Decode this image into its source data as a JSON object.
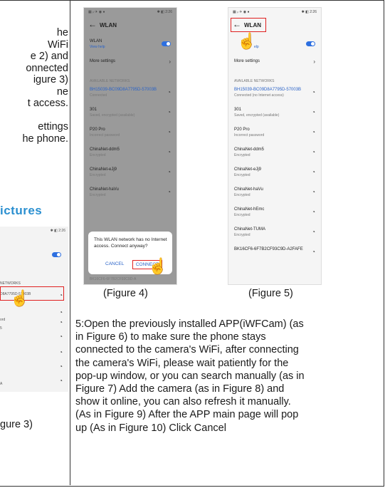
{
  "left_column": {
    "text_lines": [
      "he",
      "WiFi",
      "e 2) and",
      "onnected",
      "igure 3)",
      "ne",
      "t access.",
      "",
      "ettings",
      "he phone."
    ],
    "heading": "ictures",
    "figure3": {
      "status": "✱ ◧ 2:26",
      "rows": [
        "NETWORKS",
        "D8A7795D-57003B",
        "",
        "ord",
        "5",
        "",
        "",
        "",
        "A",
        ""
      ],
      "caption": "gure 3)"
    }
  },
  "figure4": {
    "status_left": "▦ ᵢₗ ✈ ◉ ●",
    "status_right": "✱ ◧ 2:26",
    "title": "WLAN",
    "wlan_label": "WLAN",
    "view_help": "View help",
    "more_settings": "More settings",
    "available": "AVAILABLE NETWORKS",
    "networks": [
      {
        "name": "BH15039-BC09D8A7795D-57003B",
        "status": "Connected",
        "blue": true
      },
      {
        "name": "301",
        "status": "Saved, encrypted (available)"
      },
      {
        "name": "P20 Pro",
        "status": "Incorrect password"
      },
      {
        "name": "ChinaNet-ddm5",
        "status": "Encrypted"
      },
      {
        "name": "ChinaNet-eJj9",
        "status": "Encrypted"
      },
      {
        "name": "ChinaNet-haVu",
        "status": "Encrypted"
      }
    ],
    "dialog_text": "This WLAN network has no Internet access. Connect anyway?",
    "cancel": "CANCEL",
    "connect": "CONNECT",
    "bottom_partial": "BK16CF6-6F7B2CF93C9D-A",
    "caption": "(Figure 4)"
  },
  "figure5": {
    "status_left": "▦ ᵢₗ ✈ ◉ ●",
    "status_right": "✱ ◧ 2:26",
    "title": "WLAN",
    "view_help": "elp",
    "more_settings": "More settings",
    "available": "AVAILABLE NETWORKS",
    "networks": [
      {
        "name": "BH15039-BC09D8A7795D-57003B",
        "status": "Connected (no Internet access)",
        "blue": true
      },
      {
        "name": "301",
        "status": "Saved, encrypted (available)"
      },
      {
        "name": "P20 Pro",
        "status": "Incorrect password"
      },
      {
        "name": "ChinaNet-ddm5",
        "status": "Encrypted"
      },
      {
        "name": "ChinaNet-eJj9",
        "status": "Encrypted"
      },
      {
        "name": "ChinaNet-haVu",
        "status": "Encrypted"
      },
      {
        "name": "ChinaNet-hEmc",
        "status": "Encrypted"
      },
      {
        "name": "ChinaNet-TUMA",
        "status": "Encrypted"
      },
      {
        "name": "BK16CF6-6F7B2CF93C9D-A2FAFE",
        "status": ""
      }
    ],
    "caption": "(Figure 5)"
  },
  "step5_text": "5:Open the previously installed APP(iWFCam) (as\nin Figure 6) to make sure the phone stays\nconnected to the camera's WiFi, after connecting\nthe camera's WiFi, please wait patiently for the\npop-up window, or you can search manually (as in\nFigure 7) Add the camera (as in Figure 8) and\nshow it online, you can also refresh it manually.\n(As in Figure 9) After the APP main page will pop\nup (As in Figure 10) Click Cancel",
  "colors": {
    "accent_blue": "#2a63c8",
    "heading_blue": "#2a8fd0",
    "highlight_red": "#e02020"
  }
}
